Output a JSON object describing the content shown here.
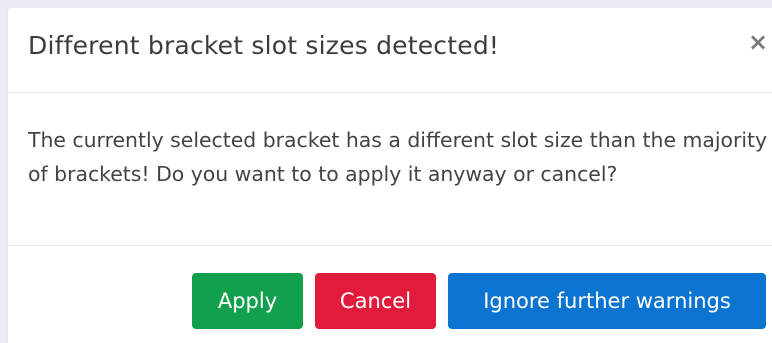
{
  "dialog": {
    "title": "Different bracket slot sizes detected!",
    "close_icon": "close-icon",
    "message": "The currently selected bracket has a different slot size than the majority of brackets! Do you want to to apply it anyway or cancel?",
    "buttons": {
      "apply": "Apply",
      "cancel": "Cancel",
      "ignore": "Ignore further warnings"
    },
    "colors": {
      "apply": "#12a04f",
      "cancel": "#e01b3c",
      "ignore": "#0b74d1",
      "background": "#e9edf3"
    }
  }
}
